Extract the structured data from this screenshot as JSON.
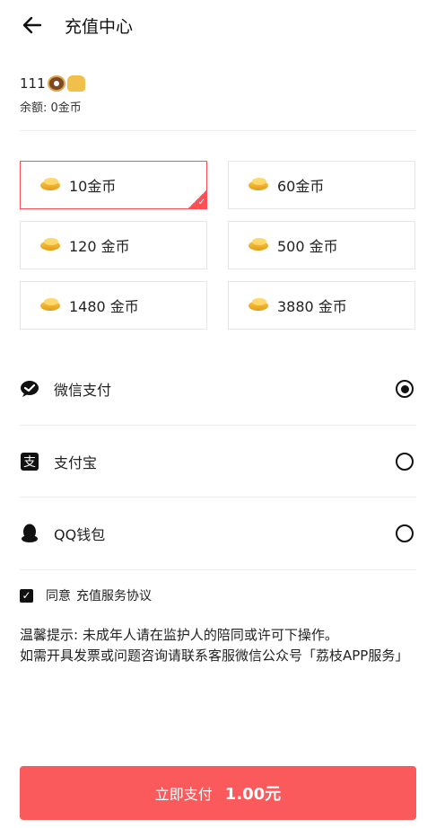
{
  "header": {
    "title": "充值中心"
  },
  "user": {
    "name": "111",
    "balance": "余额: 0金币"
  },
  "packages": [
    {
      "label": "10金币",
      "selected": true
    },
    {
      "label": "60金币",
      "selected": false
    },
    {
      "label": "120 金币",
      "selected": false
    },
    {
      "label": "500 金币",
      "selected": false
    },
    {
      "label": "1480 金币",
      "selected": false
    },
    {
      "label": "3880 金币",
      "selected": false
    }
  ],
  "payment": {
    "methods": [
      {
        "label": "微信支付",
        "icon": "wechat-pay-icon",
        "selected": true
      },
      {
        "label": "支付宝",
        "icon": "alipay-icon",
        "selected": false
      },
      {
        "label": "QQ钱包",
        "icon": "qq-wallet-icon",
        "selected": false
      }
    ]
  },
  "agreement": {
    "checked": true,
    "prefix": "同意",
    "link": "充值服务协议"
  },
  "tips": {
    "line1": "温馨提示: 未成年人请在监护人的陪同或许可下操作。",
    "line2": "如需开具发票或问题咨询请联系客服微信公众号「荔枝APP服务」"
  },
  "checkout": {
    "label": "立即支付",
    "amount": "1.00元"
  },
  "colors": {
    "accent": "#fb5a5c",
    "selected_border": "#ff4f56"
  }
}
